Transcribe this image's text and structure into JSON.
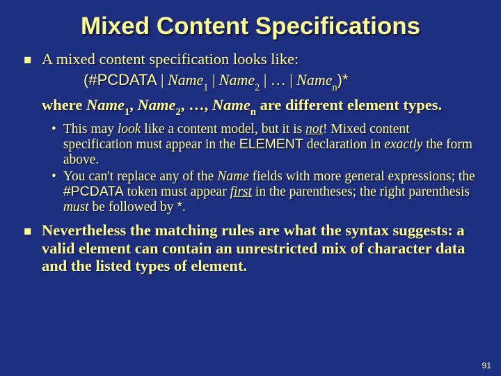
{
  "title": "Mixed Content Specifications",
  "bullet1": "A mixed content specification looks like:",
  "syntax": {
    "lparen": "(",
    "pcdata": "#PCDATA",
    "sep": " | ",
    "name": "Name",
    "sub1": "1",
    "sub2": "2",
    "dots": " … ",
    "subn": "n",
    "rparen": ")*"
  },
  "where": {
    "w1": "where ",
    "n": "Name",
    "s1": "1",
    "c": ", ",
    "s2": "2",
    "dots": ", …, ",
    "sn": "n",
    "tail": " are different element types."
  },
  "sub1": {
    "a": "This may ",
    "look": "look",
    "b": " like a content model, but it is ",
    "not": "not",
    "c": "!  Mixed content specification must appear in the ",
    "elem": "ELEMENT",
    "d": " declaration in ",
    "exact": "exactly",
    "e": " the form above."
  },
  "sub2": {
    "a": "You can't replace any of the ",
    "name": "Name",
    "b": " fields with more general expressions; the ",
    "pc": "#PCDATA",
    "c": " token must appear ",
    "first": "first",
    "d": " in the parentheses; the right parenthesis ",
    "must": "must",
    "e": " be followed by ",
    "star": "*",
    "f": "."
  },
  "bullet2": "Nevertheless the matching rules are what the syntax suggests: a valid element can contain an unrestricted mix of character data and the listed types of element.",
  "page": "91"
}
